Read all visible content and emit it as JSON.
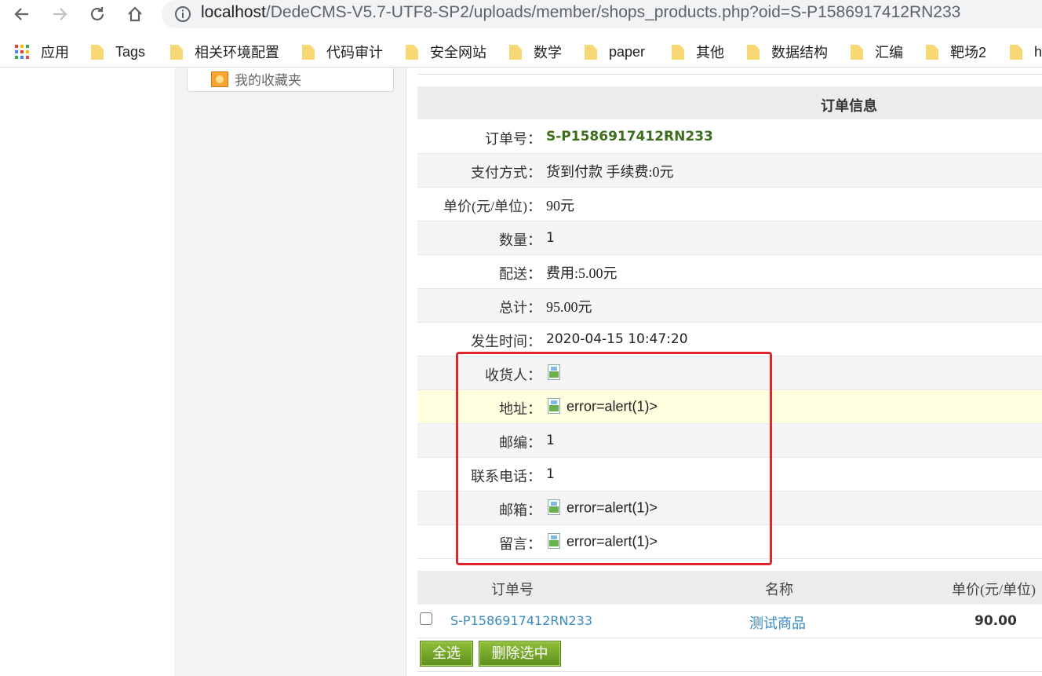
{
  "browser": {
    "url_host": "localhost",
    "url_path": "/DedeCMS-V5.7-UTF8-SP2/uploads/member/shops_products.php?oid=S-P1586917412RN233",
    "bookmarks": [
      "应用",
      "Tags",
      "相关环境配置",
      "代码审计",
      "安全网站",
      "数学",
      "paper",
      "其他",
      "数据结构",
      "汇编",
      "靶场2",
      "h"
    ]
  },
  "sidebar": {
    "favorites_label": "我的收藏夹"
  },
  "order_info": {
    "title": "订单信息",
    "rows": [
      {
        "label": "订单号：",
        "value": "S-P1586917412RN233"
      },
      {
        "label": "支付方式：",
        "value": "货到付款 手续费:0元"
      },
      {
        "label": "单价(元/单位)：",
        "value": "90元"
      },
      {
        "label": "数量：",
        "value": "1"
      },
      {
        "label": "配送：",
        "value": "费用:5.00元"
      },
      {
        "label": "总计：",
        "value": "95.00元"
      },
      {
        "label": "发生时间：",
        "value": "2020-04-15 10:47:20"
      },
      {
        "label": "收货人：",
        "value": ""
      },
      {
        "label": "地址：",
        "value": "error=alert(1)>"
      },
      {
        "label": "邮编：",
        "value": "1"
      },
      {
        "label": "联系电话：",
        "value": "1"
      },
      {
        "label": "邮箱：",
        "value": "error=alert(1)>"
      },
      {
        "label": "留言：",
        "value": "error=alert(1)>"
      }
    ]
  },
  "product_list": {
    "headers": [
      "订单号",
      "名称",
      "单价(元/单位)"
    ],
    "rows": [
      {
        "order_id": "S-P1586917412RN233",
        "name": "测试商品",
        "price": "90.00"
      }
    ]
  },
  "buttons": {
    "select_all": "全选",
    "delete_selected": "删除选中"
  },
  "colors": {
    "highlight_border": "#e0262a",
    "button_green": "#6f9f28",
    "link": "#3a8ac0",
    "order_no": "#3f6d20"
  }
}
